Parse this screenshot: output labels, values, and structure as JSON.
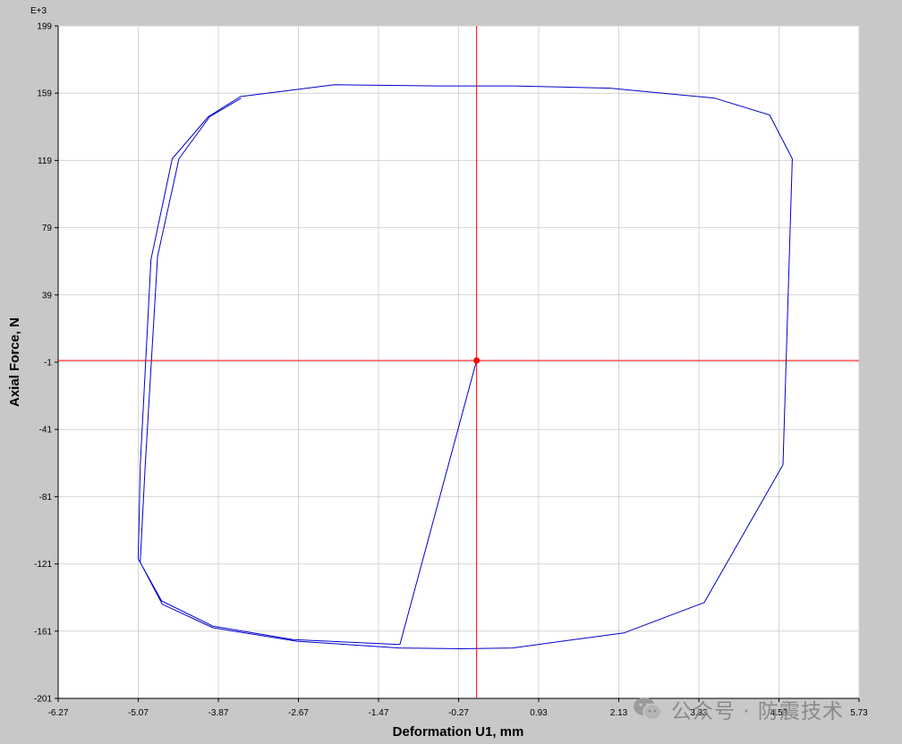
{
  "chart_data": {
    "type": "line",
    "xlabel": "Deformation U1, mm",
    "ylabel": "Axial Force, N",
    "y_exponent_label": "E+3",
    "xlim": [
      -6.27,
      5.73
    ],
    "ylim": [
      -201,
      199
    ],
    "x_ticks": [
      "-6.27",
      "-5.07",
      "-3.87",
      "-2.67",
      "-1.47",
      "-0.27",
      "0.93",
      "2.13",
      "3.33",
      "4.53",
      "5.73"
    ],
    "y_ticks": [
      "199",
      "159",
      "119",
      "79",
      "39",
      "-1",
      "-41",
      "-81",
      "-121",
      "-161",
      "-201"
    ],
    "grid": true,
    "series": [
      {
        "color": "#0000cc",
        "x": [
          0.0,
          -1.15,
          -2.75,
          -3.95,
          -4.72,
          -5.07,
          -5.04,
          -4.88,
          -4.56,
          -4.02,
          -3.54,
          -2.13,
          -0.55,
          0.55,
          2.0,
          3.57,
          4.39,
          4.73,
          4.59,
          3.41,
          2.21,
          0.54,
          -0.24,
          -1.16,
          -2.69,
          -3.95,
          -4.71,
          -5.04,
          -4.97,
          -4.78,
          -4.46,
          -4.0,
          -3.53
        ],
        "y": [
          0.0,
          -169.0,
          -166.0,
          -158.0,
          -143.0,
          -118.0,
          -63.0,
          60.0,
          120.0,
          145.0,
          157.0,
          164.0,
          163.3,
          163.3,
          162.0,
          156.0,
          146.0,
          120.0,
          -62.0,
          -144.0,
          -162.0,
          -171.0,
          -171.5,
          -171.0,
          -167.0,
          -159.0,
          -145.0,
          -120.0,
          -65.0,
          62.0,
          120.0,
          145.0,
          156.0
        ]
      }
    ],
    "marker": {
      "x": 0.0,
      "y": 0.0,
      "color": "#ff0000"
    },
    "crosshair": {
      "x": 0.0,
      "y": 0.0,
      "color": "#ff0000"
    }
  },
  "watermark": {
    "icon": "wechat-icon",
    "text": "公众号 · 防震技术"
  }
}
